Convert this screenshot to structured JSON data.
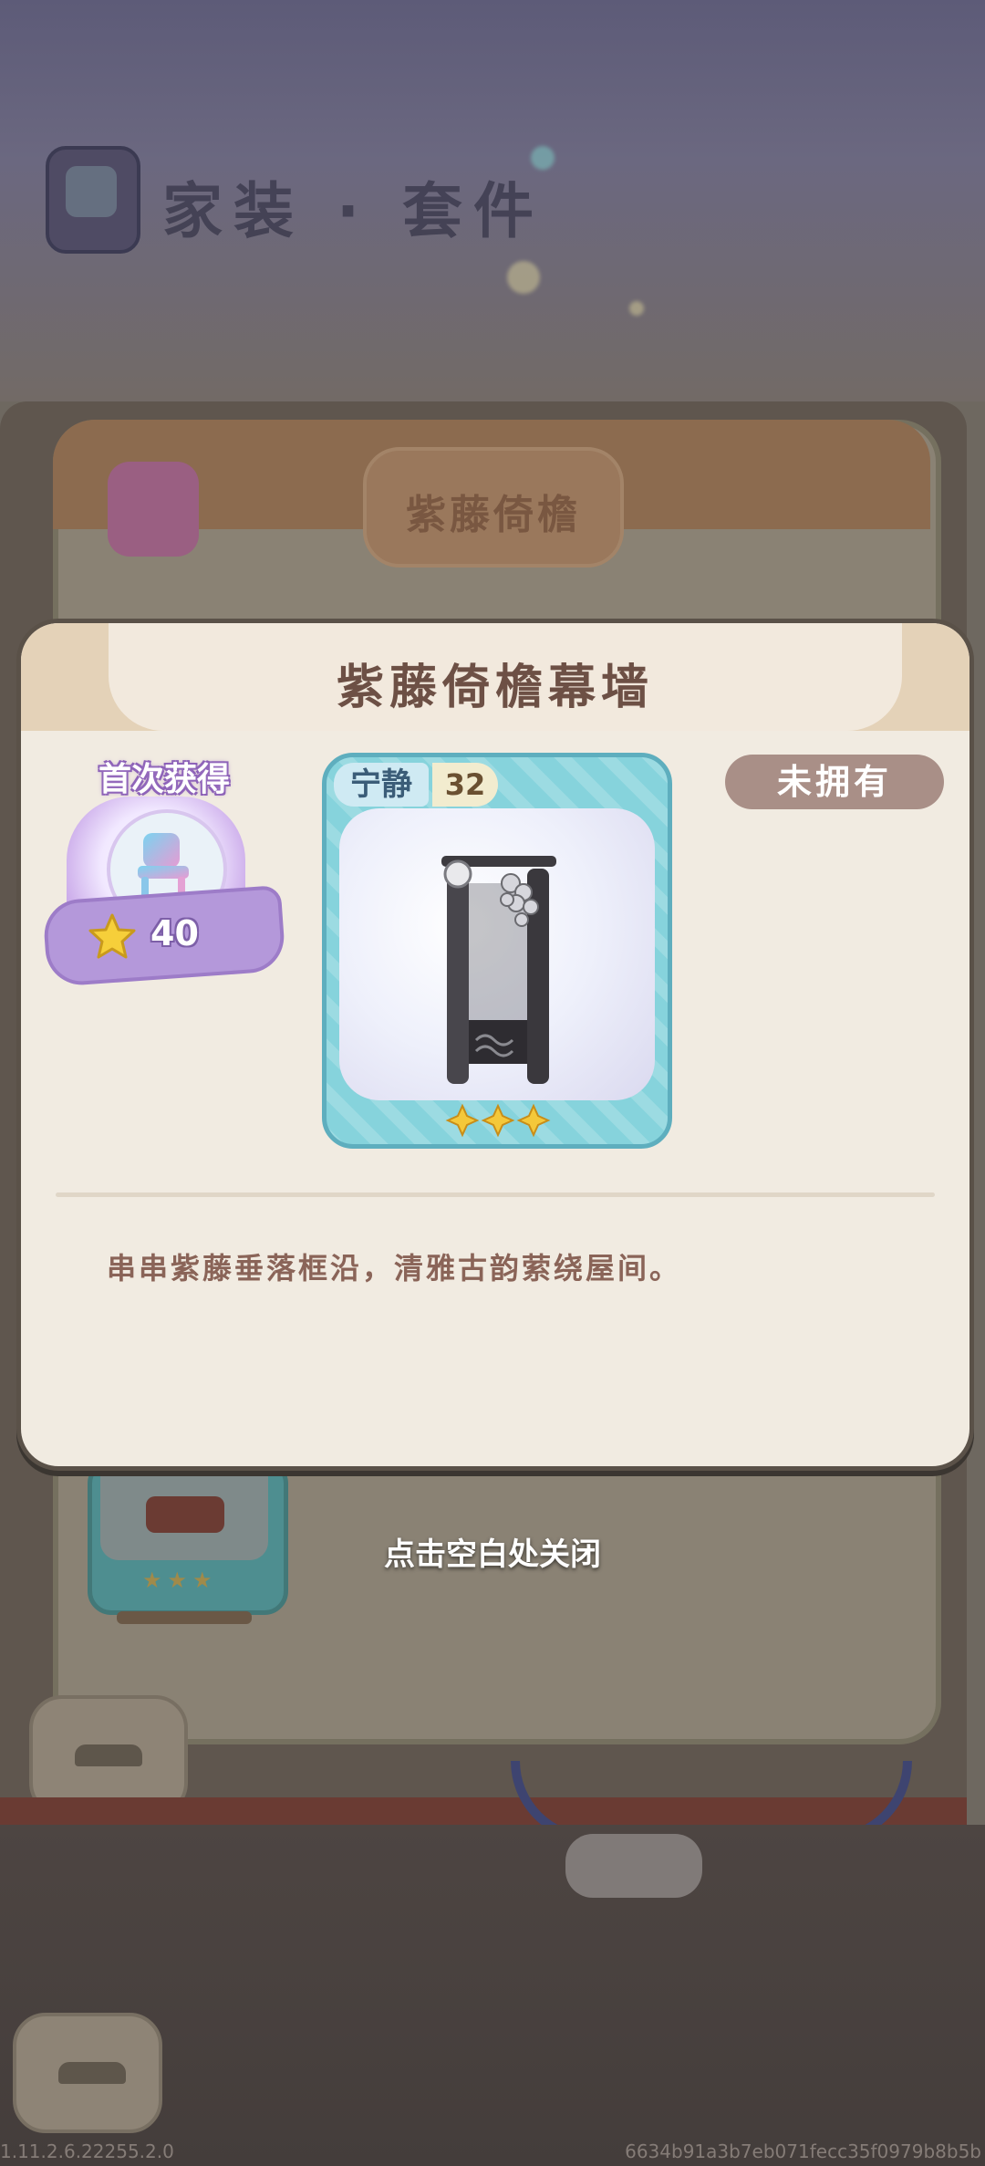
{
  "background": {
    "header_title": "家装 · 套件",
    "book_tab_label": "紫藤倚檐",
    "footer": {
      "version": "1.11.2.6.22255.2.0",
      "build_hash": "6634b91a3b7eb071fecc35f0979b8b5b"
    }
  },
  "modal": {
    "title": "紫藤倚檐幕墙",
    "first_get": {
      "label": "首次获得",
      "icon": "chair-icon",
      "reward_icon": "star-icon",
      "reward_value": "40"
    },
    "item_card": {
      "attribute_name": "宁静",
      "attribute_value": "32",
      "icon": "wisteria-curtain-wall-icon",
      "rarity_stars": 3
    },
    "ownership_status": "未拥有",
    "description": "串串紫藤垂落框沿，清雅古韵萦绕屋间。"
  },
  "close_hint": "点击空白处关闭",
  "colors": {
    "modal_background": "#f1ebe1",
    "title_text": "#6d5045",
    "card_teal": "#86d3dc",
    "badge_purple": "#b498da",
    "ownership_badge": "#a98f87",
    "description_text": "#8a6458"
  }
}
